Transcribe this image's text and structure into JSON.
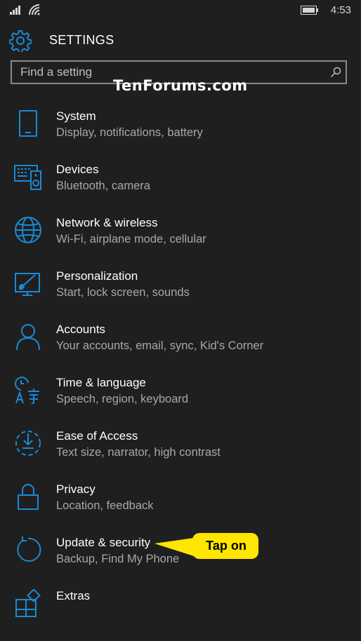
{
  "status_bar": {
    "time": "4:53"
  },
  "header": {
    "title": "SETTINGS"
  },
  "search": {
    "placeholder": "Find a setting"
  },
  "watermark": "TenForums.com",
  "items": [
    {
      "name": "System",
      "sub": "Display, notifications, battery",
      "icon": "phone-icon"
    },
    {
      "name": "Devices",
      "sub": "Bluetooth, camera",
      "icon": "devices-icon"
    },
    {
      "name": "Network & wireless",
      "sub": "Wi-Fi, airplane mode, cellular",
      "icon": "globe-icon"
    },
    {
      "name": "Personalization",
      "sub": "Start, lock screen, sounds",
      "icon": "paint-icon"
    },
    {
      "name": "Accounts",
      "sub": "Your accounts, email, sync, Kid's Corner",
      "icon": "person-icon"
    },
    {
      "name": "Time & language",
      "sub": "Speech, region, keyboard",
      "icon": "time-language-icon"
    },
    {
      "name": "Ease of Access",
      "sub": "Text size, narrator, high contrast",
      "icon": "ease-of-access-icon"
    },
    {
      "name": "Privacy",
      "sub": "Location, feedback",
      "icon": "lock-icon"
    },
    {
      "name": "Update & security",
      "sub": "Backup, Find My Phone",
      "icon": "refresh-icon"
    },
    {
      "name": "Extras",
      "sub": "",
      "icon": "extras-icon"
    }
  ],
  "callout": {
    "text": "Tap on"
  },
  "colors": {
    "accent": "#1a8ad4",
    "background": "#1f1f1f",
    "callout": "#ffe600"
  }
}
